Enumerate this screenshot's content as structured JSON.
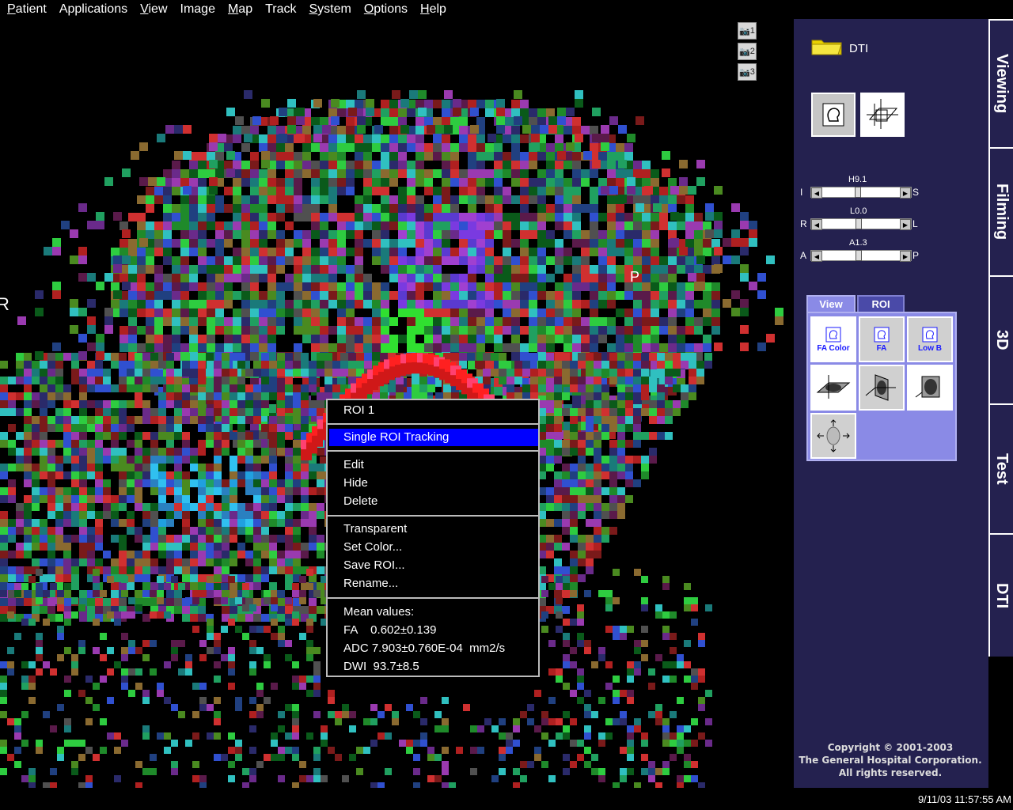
{
  "menu": [
    {
      "pre": "",
      "u": "P",
      "post": "atient"
    },
    {
      "pre": "Applications",
      "u": "",
      "post": ""
    },
    {
      "pre": "",
      "u": "V",
      "post": "iew"
    },
    {
      "pre": "Image",
      "u": "",
      "post": ""
    },
    {
      "pre": "",
      "u": "M",
      "post": "ap"
    },
    {
      "pre": "Track",
      "u": "",
      "post": ""
    },
    {
      "pre": "",
      "u": "S",
      "post": "ystem"
    },
    {
      "pre": "",
      "u": "O",
      "post": "ptions"
    },
    {
      "pre": "",
      "u": "H",
      "post": "elp"
    }
  ],
  "camera_buttons": [
    "1",
    "2",
    "3"
  ],
  "folder_label": "DTI",
  "sliders": [
    {
      "left": "I",
      "right": "S",
      "value": "H9.1"
    },
    {
      "left": "R",
      "right": "L",
      "value": "L0.0"
    },
    {
      "left": "A",
      "right": "P",
      "value": "A1.3"
    }
  ],
  "panel_tabs": {
    "view": "View",
    "roi": "ROI"
  },
  "grid_buttons": {
    "fa_color": "FA Color",
    "fa": "FA",
    "low_b": "Low B"
  },
  "side_tabs": [
    "Viewing",
    "Filming",
    "3D",
    "Test",
    "DTI"
  ],
  "context_menu": {
    "title": "ROI 1",
    "tracking": "Single ROI Tracking",
    "edit": "Edit",
    "hide": "Hide",
    "delete": "Delete",
    "transparent": "Transparent",
    "set_color": "Set Color...",
    "save_roi": "Save ROI...",
    "rename": "Rename...",
    "mean_label": "Mean values:",
    "fa_line": "FA    0.602±0.139",
    "adc_line": "ADC 7.903±0.760E-04  mm2/s",
    "dwi_line": "DWI  93.7±8.5"
  },
  "copyright": {
    "line1": "Copyright © 2001-2003",
    "line2": "The General Hospital Corporation.",
    "line3": "All rights reserved."
  },
  "clock": "9/11/03 11:57:55 AM",
  "viewport_letters": {
    "left": "R",
    "right": "P"
  }
}
